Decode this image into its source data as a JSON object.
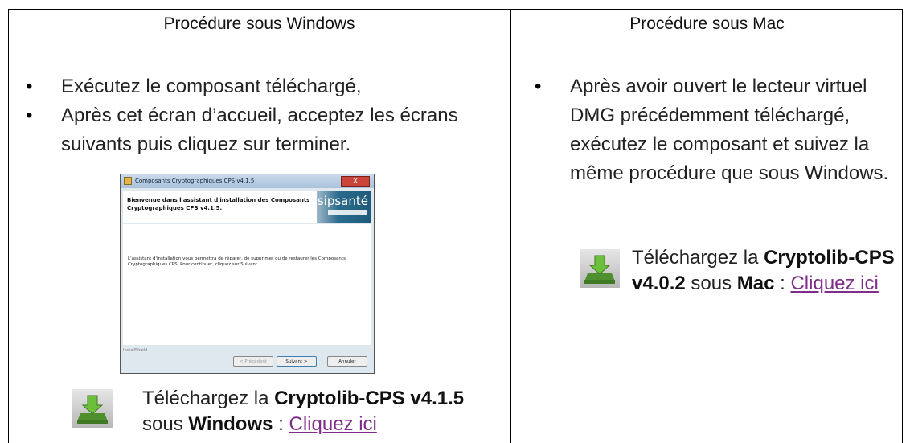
{
  "headers": {
    "windows": "Procédure sous Windows",
    "mac": "Procédure sous Mac"
  },
  "windows": {
    "bullets": [
      "Exécutez le composant téléchargé,",
      "Après cet écran d’accueil, acceptez les écrans suivants puis cliquez sur terminer."
    ],
    "download": {
      "prefix": "Téléchargez la ",
      "product": "Cryptolib-CPS v4.1.5",
      "middle": " sous ",
      "os": "Windows",
      "sep": " : ",
      "link": "Cliquez ici"
    }
  },
  "mac": {
    "bullets": [
      "Après avoir ouvert le lecteur virtuel DMG précédemment téléchargé, exécutez le composant et suivez la même procédure que sous Windows."
    ],
    "download": {
      "prefix": "Téléchargez la ",
      "product": "Cryptolib-CPS v4.0.2",
      "middle": " sous ",
      "os": "Mac",
      "sep": " : ",
      "link": "Cliquez ici"
    }
  },
  "screenshot": {
    "window_title": "Composants Cryptographiques CPS v4.1.5",
    "close": "x",
    "banner_title": "Bienvenue dans l'assistant d'installation des Composants Cryptographiques CPS v4.1.5.",
    "logo": "asipsanté",
    "body_text": "L'assistant d'installation vous permettra de réparer, de supprimer ou de restaurer les Composants Cryptographiques CPS. Pour continuer, cliquez sur Suivant.",
    "footer_label": "InstallShield",
    "buttons": {
      "back": "< Précédent",
      "next": "Suivant >",
      "cancel": "Annuler"
    }
  },
  "colors": {
    "link": "#7f2d8a",
    "icon_green": "#5aa33a"
  }
}
